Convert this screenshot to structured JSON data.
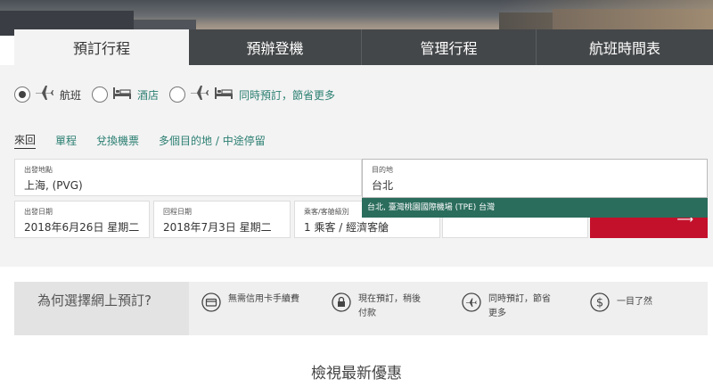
{
  "tabs": [
    {
      "label": "預訂行程",
      "active": true
    },
    {
      "label": "預辦登機",
      "active": false
    },
    {
      "label": "管理行程",
      "active": false
    },
    {
      "label": "航班時間表",
      "active": false
    }
  ],
  "booking_type": {
    "options": [
      {
        "label": "航班",
        "icons": [
          "plane-icon"
        ],
        "checked": true
      },
      {
        "label": "酒店",
        "icons": [
          "bed-icon"
        ],
        "checked": false
      },
      {
        "label": "同時預訂，節省更多",
        "icons": [
          "plane-icon",
          "bed-icon"
        ],
        "checked": false
      }
    ]
  },
  "trip_types": [
    {
      "label": "來回",
      "active": true
    },
    {
      "label": "單程",
      "active": false
    },
    {
      "label": "兌換機票",
      "active": false
    },
    {
      "label": "多個目的地 / 中途停留",
      "active": false
    }
  ],
  "fields": {
    "origin": {
      "label": "出發地點",
      "value": "上海, (PVG)"
    },
    "destination": {
      "label": "目的地",
      "value": "台北"
    },
    "depart": {
      "label": "出發日期",
      "value": "2018年6月26日 星期二"
    },
    "return": {
      "label": "回程日期",
      "value": "2018年7月3日 星期二"
    },
    "passengers": {
      "label": "乘客/客艙級別",
      "value": "1 乘客 / 經濟客艙"
    }
  },
  "autocomplete": {
    "suggestion": "台北, 臺灣桃園國際機場 (TPE) 台灣"
  },
  "why": {
    "title": "為何選擇網上預訂?",
    "features": [
      {
        "icon": "credit-card-icon",
        "text": "無需信用卡手續費"
      },
      {
        "icon": "lock-icon",
        "text": "現在預訂，稍後付款"
      },
      {
        "icon": "plane-icon",
        "text": "同時預訂，節省更多"
      },
      {
        "icon": "dollar-icon",
        "text": "一目了然"
      }
    ]
  },
  "offers": {
    "title": "檢視最新優惠"
  },
  "colors": {
    "accent_teal": "#2b6d5d",
    "tab_dark": "#444749",
    "search_red": "#c3112b"
  }
}
